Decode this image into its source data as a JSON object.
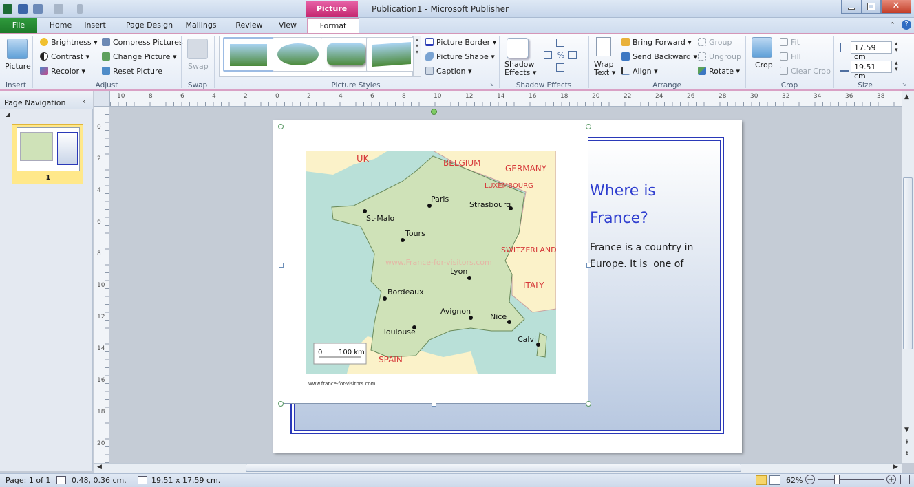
{
  "window": {
    "title": "Publication1 - Microsoft Publisher",
    "contextual_tab": "Picture Tools"
  },
  "tabs": [
    "File",
    "Home",
    "Insert",
    "Page Design",
    "Mailings",
    "Review",
    "View",
    "Format"
  ],
  "active_tab": "Format",
  "ribbon": {
    "insert": {
      "picture": "Picture",
      "label": "Insert"
    },
    "adjust": {
      "brightness": "Brightness",
      "contrast": "Contrast",
      "recolor": "Recolor",
      "compress": "Compress Pictures",
      "change": "Change Picture",
      "reset": "Reset Picture",
      "label": "Adjust"
    },
    "swap": {
      "swap": "Swap",
      "label": "Swap"
    },
    "picture_styles": {
      "border": "Picture Border",
      "shape": "Picture Shape",
      "caption": "Caption",
      "label": "Picture Styles"
    },
    "shadow": {
      "shadow_effects": "Shadow Effects",
      "shadow_line1": "Shadow",
      "shadow_line2": "Effects",
      "label": "Shadow Effects"
    },
    "arrange": {
      "wrap_line1": "Wrap",
      "wrap_line2": "Text",
      "bring_forward": "Bring Forward",
      "send_backward": "Send Backward",
      "align": "Align",
      "group": "Group",
      "ungroup": "Ungroup",
      "rotate": "Rotate",
      "label": "Arrange"
    },
    "crop": {
      "crop": "Crop",
      "fit": "Fit",
      "fill": "Fill",
      "clear_crop": "Clear Crop",
      "label": "Crop"
    },
    "size": {
      "height": "17.59 cm",
      "width": "19.51 cm",
      "label": "Size"
    }
  },
  "nav": {
    "title": "Page Navigation",
    "page_number": "1"
  },
  "ruler_h": [
    "10",
    "8",
    "6",
    "4",
    "2",
    "0",
    "2",
    "4",
    "6",
    "8",
    "10",
    "12",
    "14",
    "16",
    "18",
    "20",
    "22",
    "24",
    "26",
    "28",
    "30",
    "32",
    "34",
    "36",
    "38"
  ],
  "ruler_v": [
    "0",
    "2",
    "4",
    "6",
    "8",
    "10",
    "12",
    "14",
    "16",
    "18",
    "20"
  ],
  "map": {
    "countries": [
      "UK",
      "BELGIUM",
      "GERMANY",
      "LUXEMBOURG",
      "SWITZERLAND",
      "ITALY",
      "SPAIN"
    ],
    "cities": [
      "Paris",
      "Strasbourg",
      "St-Malo",
      "Tours",
      "Lyon",
      "Bordeaux",
      "Avignon",
      "Nice",
      "Toulouse",
      "Calvi"
    ],
    "watermark": "www.France-for-visitors.com",
    "scale_0": "0",
    "scale_100": "100 km",
    "credit": "www.france-for-visitors.com"
  },
  "page": {
    "heading_line1": "Where is",
    "heading_line2": "France?",
    "body_line1": "France is a country in",
    "body_line2": "Europe. It is  one of"
  },
  "status": {
    "page": "Page: 1 of 1",
    "position": "0.48, 0.36 cm.",
    "size": "19.51 x 17.59 cm.",
    "zoom": "62%"
  }
}
